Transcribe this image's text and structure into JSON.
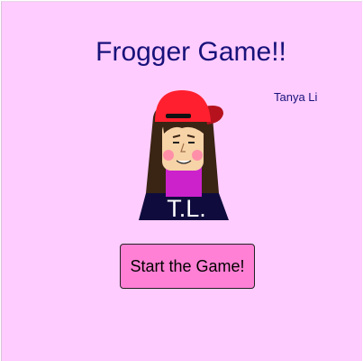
{
  "game": {
    "title": "Frogger Game!!",
    "author": "Tanya Li",
    "start_label": "Start the Game!"
  },
  "avatar": {
    "shirt_initials": "T.L.",
    "colors": {
      "background": "#ffccff",
      "title_text": "#18127a",
      "cap": "#ff1f2e",
      "cap_brim": "#b5121e",
      "hair": "#3a2414",
      "skin": "#f7d3a8",
      "cheeks": "#ff8fa8",
      "neck_top": "#cc22cc",
      "shirt": "#0f0c3d",
      "button": "#ff80d5"
    }
  }
}
